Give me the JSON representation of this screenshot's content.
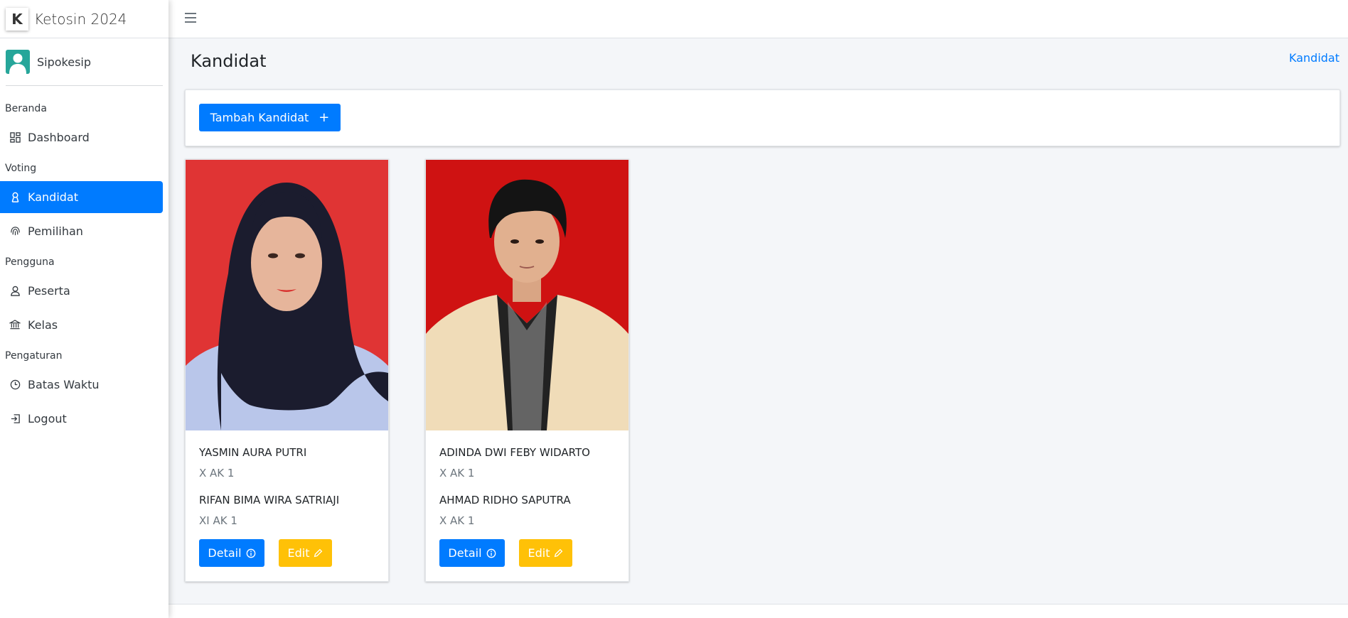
{
  "brand": {
    "logo_letter": "K",
    "title": "Ketosin 2024"
  },
  "user": {
    "name": "Sipokesip"
  },
  "sidebar": {
    "sections": [
      {
        "header": "Beranda",
        "items": [
          {
            "label": "Dashboard",
            "icon": "dashboard-icon",
            "active": false
          }
        ]
      },
      {
        "header": "Voting",
        "items": [
          {
            "label": "Kandidat",
            "icon": "user-badge-icon",
            "active": true
          },
          {
            "label": "Pemilihan",
            "icon": "fingerprint-icon",
            "active": false
          }
        ]
      },
      {
        "header": "Pengguna",
        "items": [
          {
            "label": "Peserta",
            "icon": "person-icon",
            "active": false
          },
          {
            "label": "Kelas",
            "icon": "bank-icon",
            "active": false
          }
        ]
      },
      {
        "header": "Pengaturan",
        "items": [
          {
            "label": "Batas Waktu",
            "icon": "clock-icon",
            "active": false
          },
          {
            "label": "Logout",
            "icon": "logout-icon",
            "active": false
          }
        ]
      }
    ]
  },
  "page": {
    "title": "Kandidat",
    "breadcrumb": "Kandidat"
  },
  "actions": {
    "add_label": "Tambah Kandidat",
    "add_icon": "plus-icon",
    "add_symbol": "+"
  },
  "candidates": [
    {
      "ketua_name": "YASMIN AURA PUTRI",
      "ketua_class": "X AK 1",
      "wakil_name": "RIFAN BIMA WIRA SATRIAJI",
      "wakil_class": "XI AK 1",
      "detail_label": "Detail",
      "edit_label": "Edit",
      "photo_bg": "#e03434"
    },
    {
      "ketua_name": "ADINDA DWI FEBY WIDARTO",
      "ketua_class": "X AK 1",
      "wakil_name": "AHMAD RIDHO SAPUTRA",
      "wakil_class": "X AK 1",
      "detail_label": "Detail",
      "edit_label": "Edit",
      "photo_bg": "#cf1212"
    }
  ],
  "colors": {
    "primary": "#007bff",
    "warning": "#ffc107",
    "avatar": "#26a69a"
  }
}
